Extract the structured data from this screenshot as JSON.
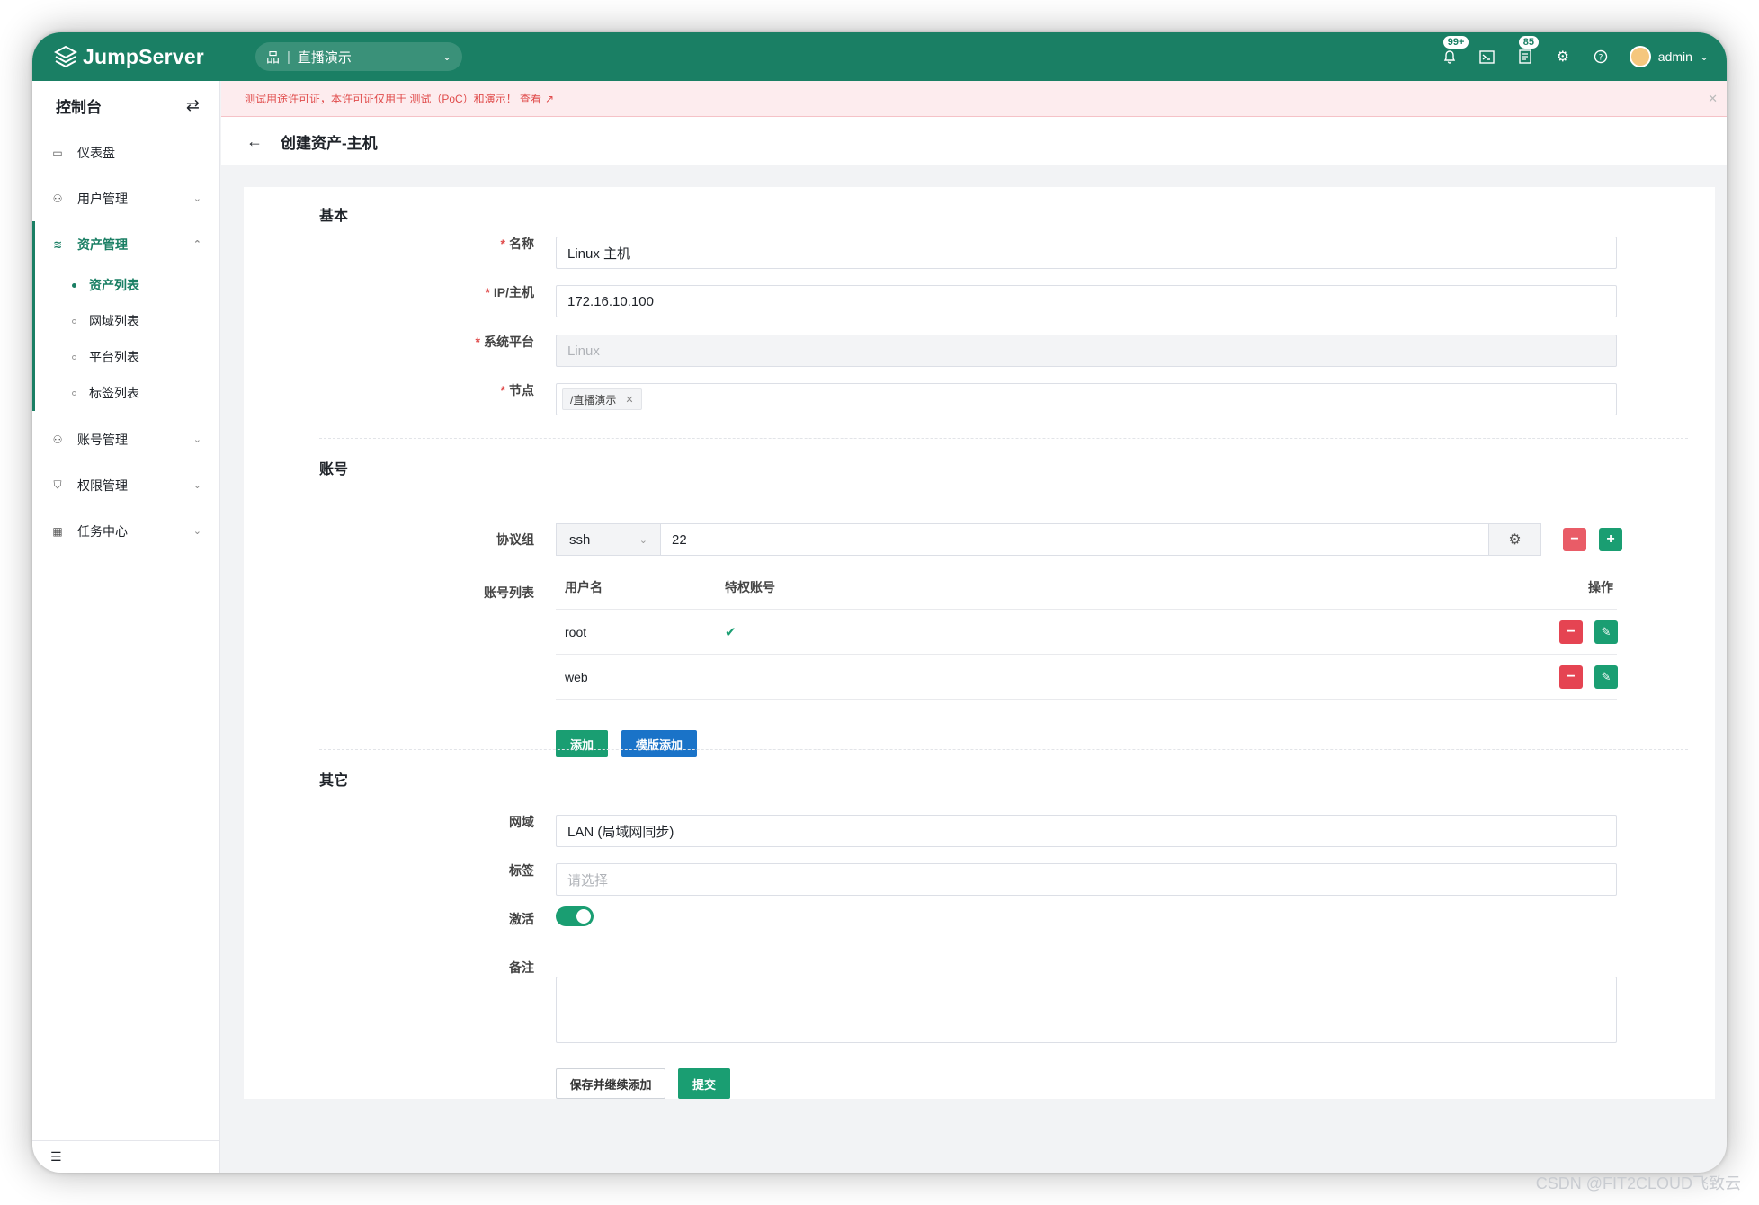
{
  "topbar": {
    "logo_text": "JumpServer",
    "org_icon": "org-icon",
    "org_name": "直播演示",
    "notif_badge": "99+",
    "ticket_badge": "85",
    "username": "admin",
    "icons": [
      "bell-icon",
      "terminal-icon",
      "ticket-icon",
      "gear-icon",
      "help-icon"
    ]
  },
  "sidebar": {
    "title": "控制台",
    "items": [
      {
        "label": "仪表盘",
        "icon": "dashboard-icon"
      },
      {
        "label": "用户管理",
        "icon": "users-icon"
      },
      {
        "label": "资产管理",
        "icon": "assets-icon",
        "active": true
      },
      {
        "label": "账号管理",
        "icon": "accounts-icon"
      },
      {
        "label": "权限管理",
        "icon": "shield-icon"
      },
      {
        "label": "任务中心",
        "icon": "calendar-icon"
      }
    ],
    "subitems": [
      {
        "label": "资产列表",
        "active": true
      },
      {
        "label": "网域列表"
      },
      {
        "label": "平台列表"
      },
      {
        "label": "标签列表"
      }
    ]
  },
  "notice": {
    "text": "测试用途许可证，本许可证仅用于 测试（PoC）和演示！ 查看"
  },
  "page": {
    "title": "创建资产-主机"
  },
  "form": {
    "basic": {
      "section_title": "基本",
      "name_label": "名称",
      "name_value": "Linux 主机",
      "ip_label": "IP/主机",
      "ip_value": "172.16.10.100",
      "platform_label": "系统平台",
      "platform_value": "Linux",
      "node_label": "节点",
      "node_tag": "/直播演示"
    },
    "account": {
      "section_title": "账号",
      "protocol_label": "协议组",
      "protocol_value": "ssh",
      "port_value": "22",
      "list_label": "账号列表",
      "columns": [
        "用户名",
        "特权账号",
        "操作"
      ],
      "rows": [
        {
          "username": "root",
          "privileged": true
        },
        {
          "username": "web",
          "privileged": false
        }
      ],
      "add_button": "添加",
      "template_add_button": "模版添加"
    },
    "other": {
      "section_title": "其它",
      "domain_label": "网域",
      "domain_value": "LAN (局域网同步)",
      "labels_label": "标签",
      "labels_placeholder": "请选择",
      "active_label": "激活",
      "active_value": true,
      "comment_label": "备注"
    },
    "save_continue_button": "保存并继续添加",
    "submit_button": "提交"
  },
  "watermark": "CSDN @FIT2CLOUD飞致云",
  "colors": {
    "brand": "#1a7f64",
    "danger": "#e54452",
    "primary_blue": "#1a73c8"
  }
}
